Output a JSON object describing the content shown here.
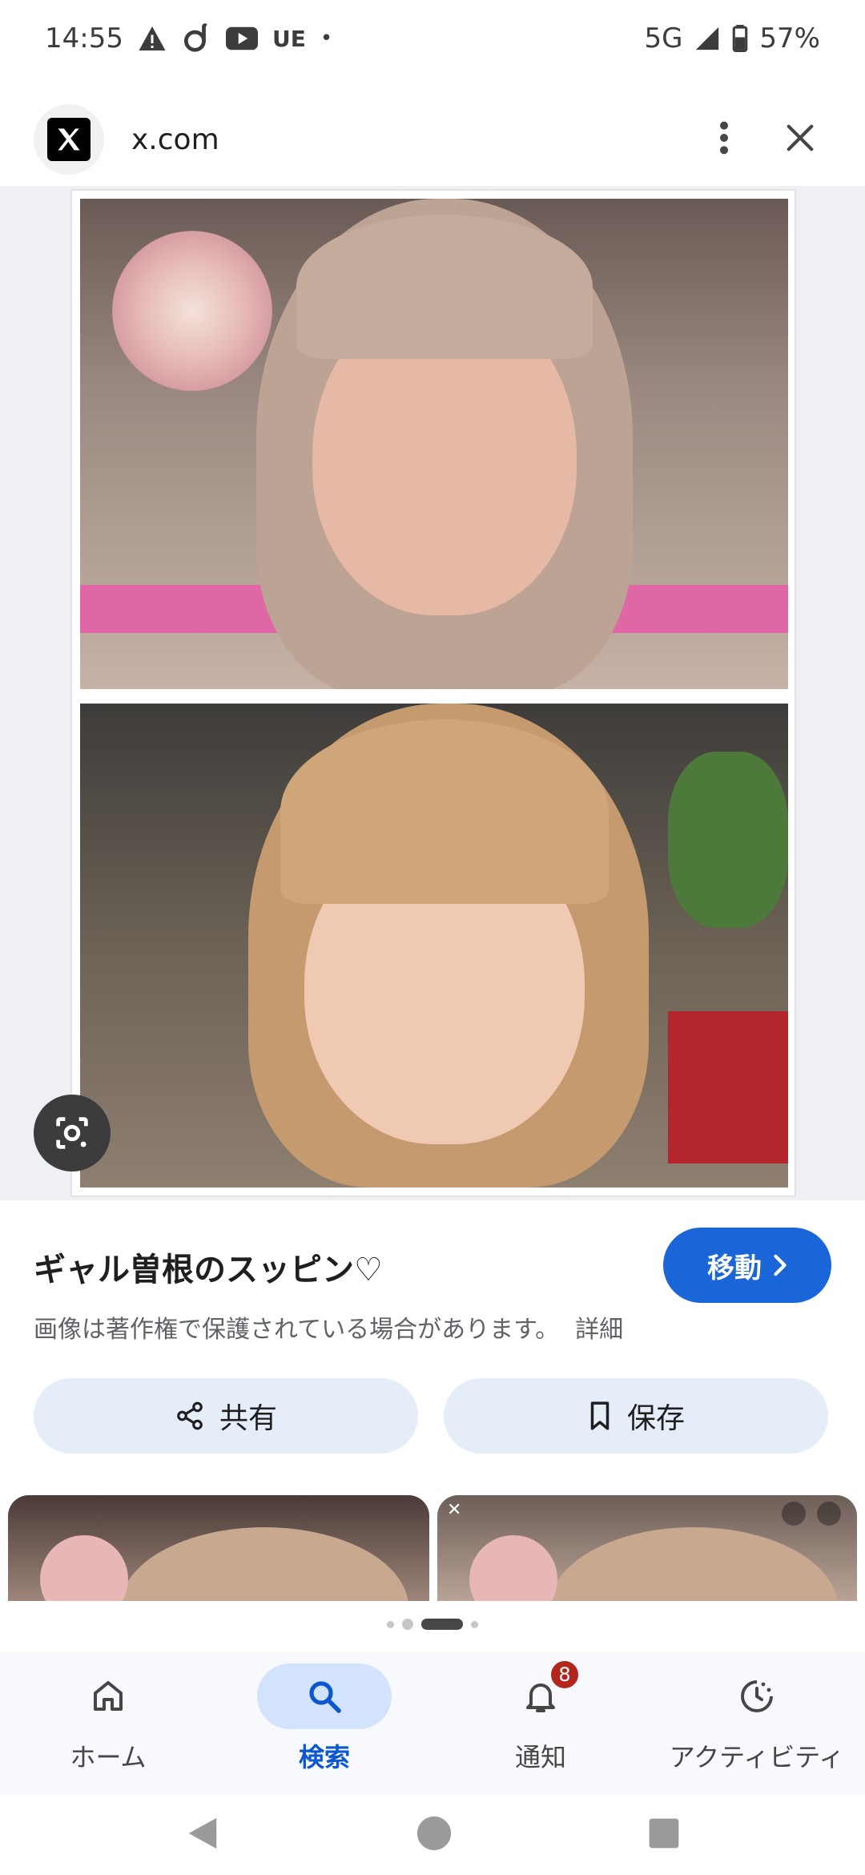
{
  "status_bar": {
    "time": "14:55",
    "carrier_tag": "UE",
    "network": "5G",
    "battery": "57%"
  },
  "browser": {
    "url": "x.com",
    "site_icon": "x-logo-icon",
    "menu_icon": "more-vert-icon",
    "close_icon": "close-icon"
  },
  "image_viewer": {
    "lens_icon": "google-lens-icon"
  },
  "result": {
    "title": "ギャル曽根のスッピン♡",
    "go_button": "移動",
    "copyright": "画像は著作権で保護されている場合があります。",
    "details_link": "詳細",
    "share_button": "共有",
    "save_button": "保存"
  },
  "carousel": {
    "page_count": 4,
    "active_page": 3
  },
  "bottom_nav": {
    "items": [
      {
        "label": "ホーム",
        "icon": "home-icon",
        "active": false
      },
      {
        "label": "検索",
        "icon": "search-icon",
        "active": true
      },
      {
        "label": "通知",
        "icon": "bell-icon",
        "active": false,
        "badge": "8"
      },
      {
        "label": "アクティビティ",
        "icon": "activity-icon",
        "active": false
      }
    ]
  },
  "colors": {
    "primary": "#1a66d9",
    "pill_bg": "#e5edf9",
    "active_nav_bg": "#d3e3fd",
    "badge": "#b3261e"
  }
}
